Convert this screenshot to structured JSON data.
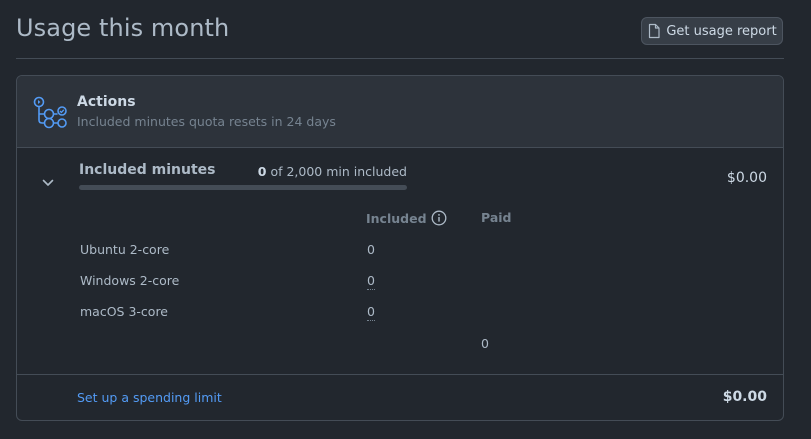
{
  "page": {
    "title": "Usage this month",
    "report_button": "Get usage report"
  },
  "actions": {
    "title": "Actions",
    "subtitle": "Included minutes quota resets in 24 days",
    "included_minutes": {
      "label": "Included minutes",
      "used": "0",
      "of_text": " of 2,000 min included",
      "progress_fraction": 0
    },
    "total": "$0.00",
    "columns": {
      "included": "Included",
      "paid": "Paid"
    },
    "rows": [
      {
        "label": "Ubuntu 2-core",
        "included": "0"
      },
      {
        "label": "Windows 2-core",
        "included": "0"
      },
      {
        "label": "macOS 3-core",
        "included": "0"
      }
    ],
    "paid_total": "0"
  },
  "footer": {
    "spending_limit_link": "Set up a spending limit",
    "total": "$0.00"
  },
  "colors": {
    "background": "#22272e",
    "header_background": "#2d333b",
    "accent": "#539bf5",
    "border": "#444c56"
  },
  "icons": {
    "report": "file-icon",
    "actions": "actions-workflow-icon",
    "expand": "chevron-down-icon",
    "info": "info-icon"
  }
}
